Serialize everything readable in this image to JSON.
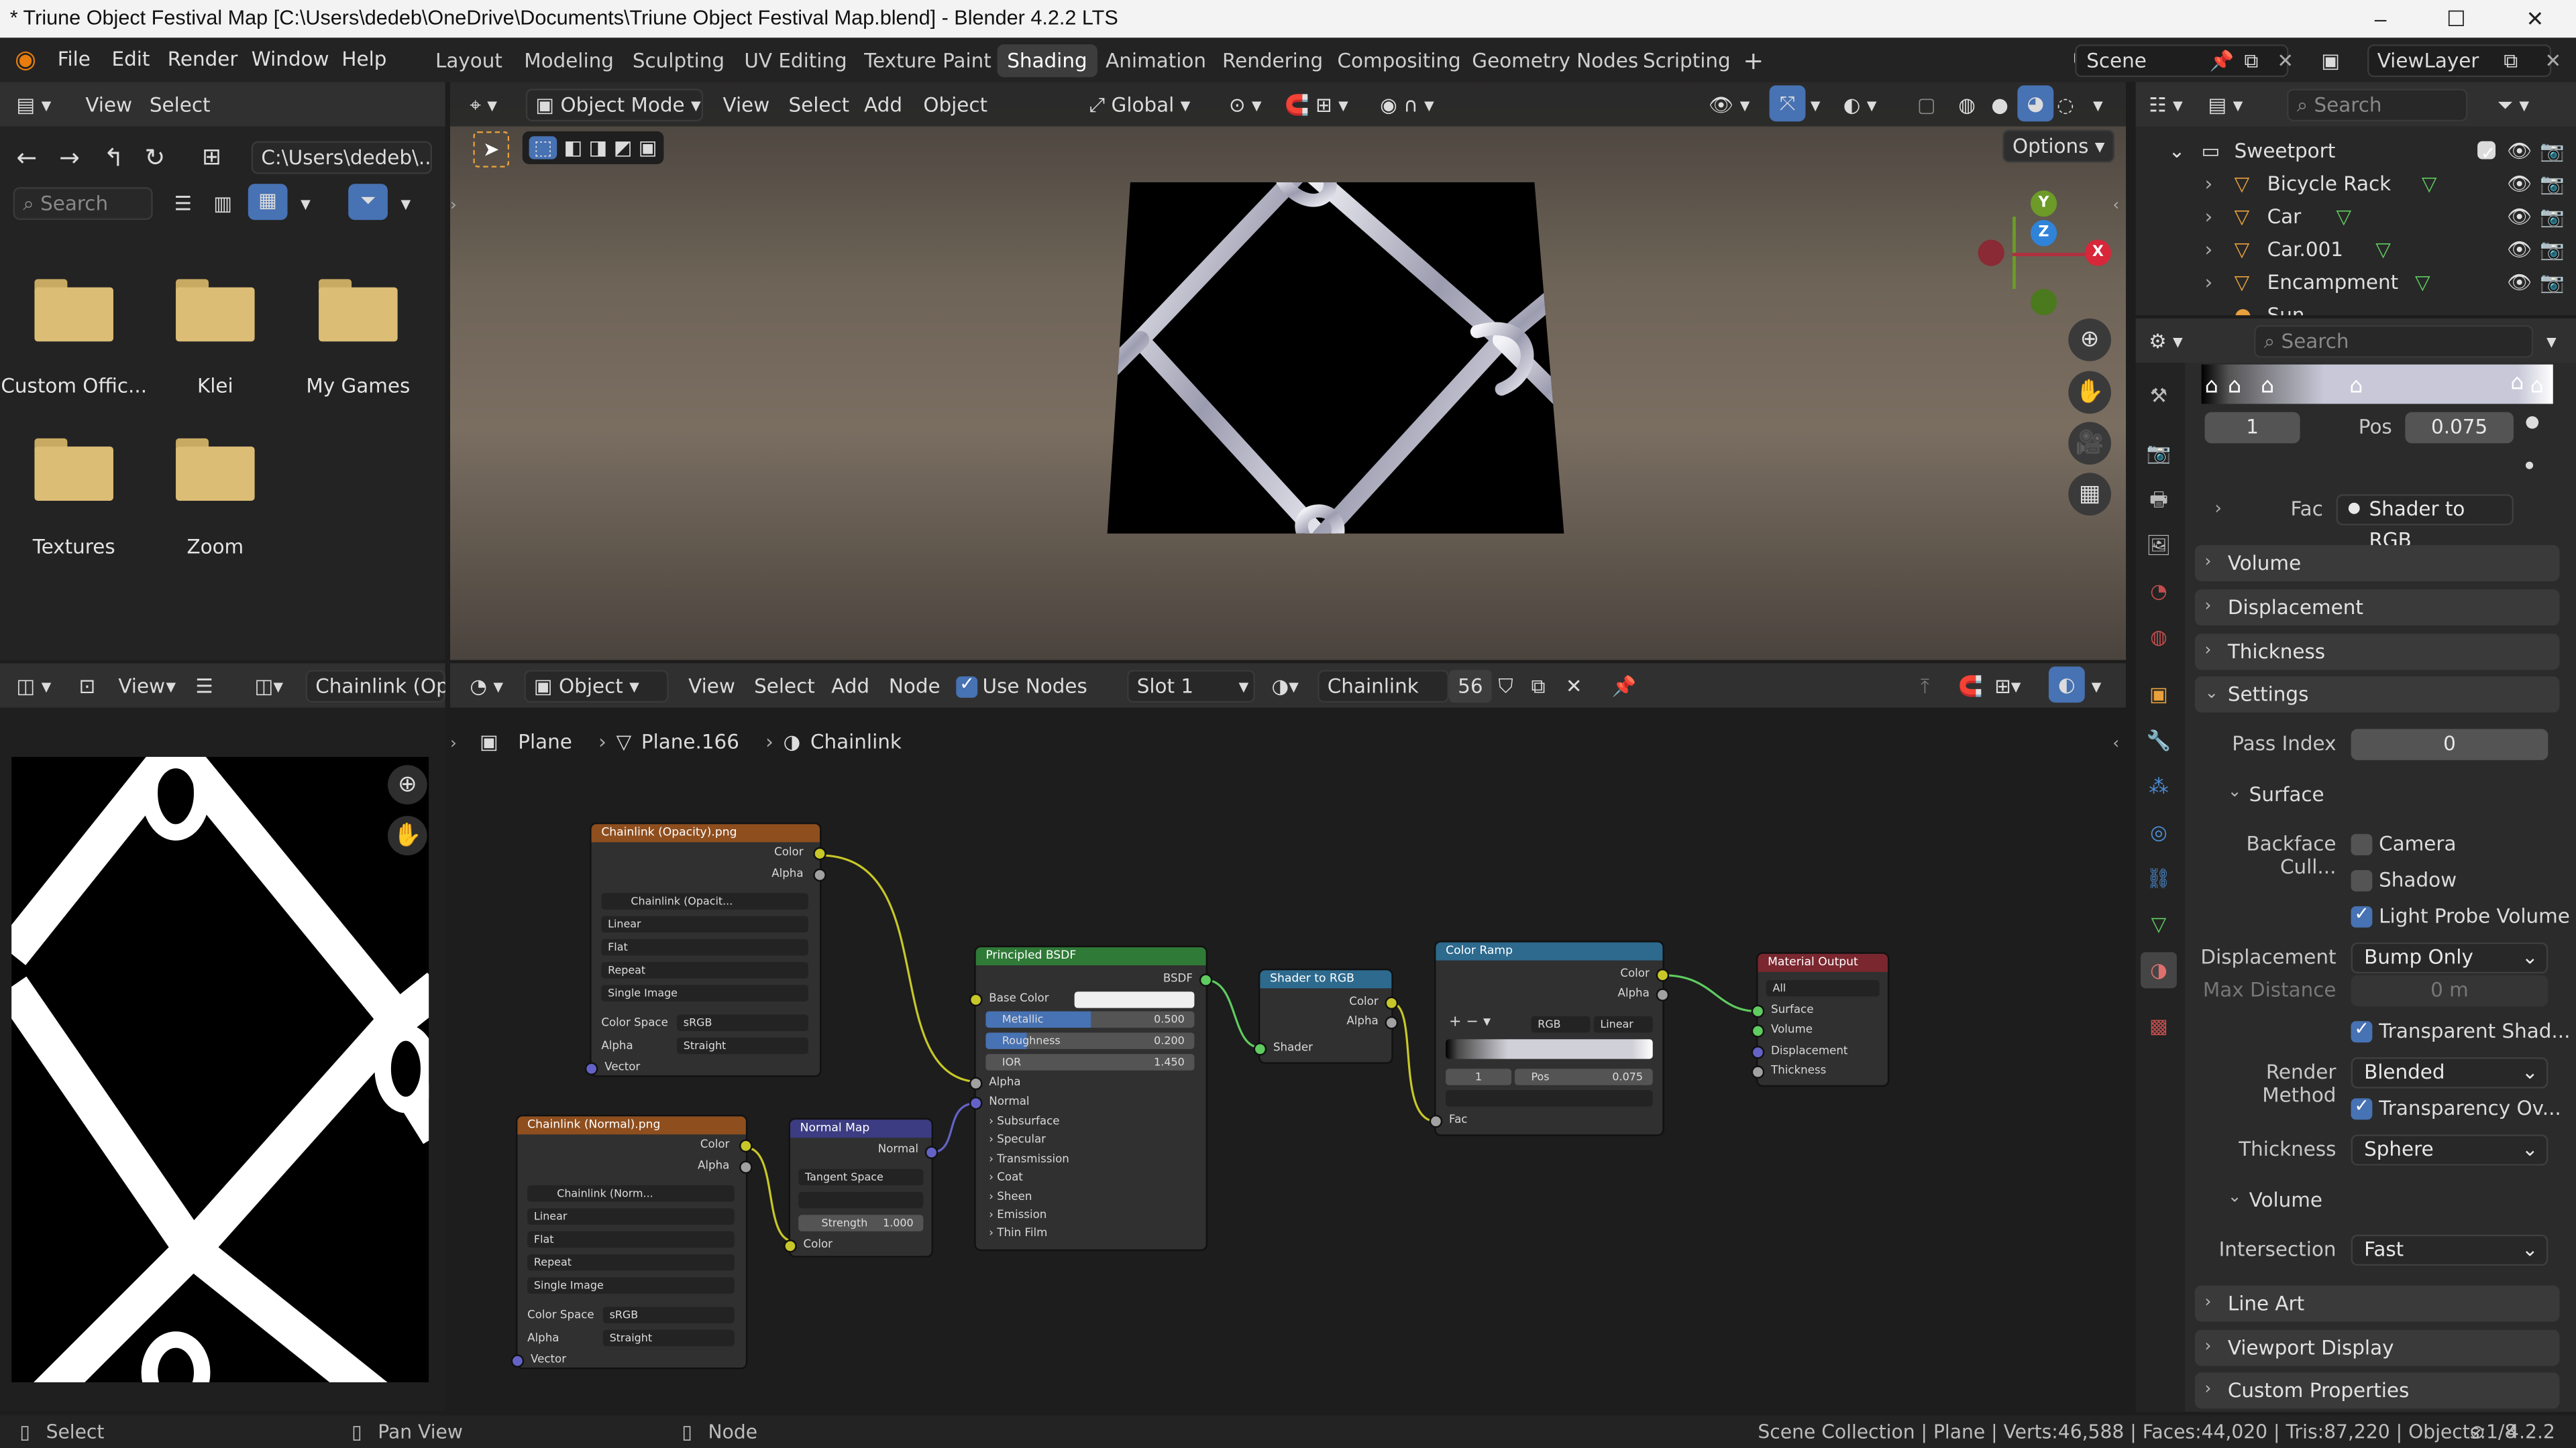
{
  "window": {
    "title": "* Triune Object Festival Map [C:\\Users\\dedeb\\OneDrive\\Documents\\Triune Object Festival Map.blend] - Blender 4.2.2 LTS",
    "minimize": "–",
    "maximize": "☐",
    "close": "✕"
  },
  "menu": [
    "File",
    "Edit",
    "Render",
    "Window",
    "Help"
  ],
  "workspaces": [
    "Layout",
    "Modeling",
    "Sculpting",
    "UV Editing",
    "Texture Paint",
    "Shading",
    "Animation",
    "Rendering",
    "Compositing",
    "Geometry Nodes",
    "Scripting",
    "+"
  ],
  "active_workspace": "Shading",
  "scene": {
    "name": "Scene",
    "view_layer": "ViewLayer"
  },
  "file_browser": {
    "menus": [
      "View",
      "Select"
    ],
    "path": "C:\\Users\\dedeb\\...",
    "search_placeholder": "Search",
    "folders": [
      "Custom Offic...",
      "Klei",
      "My Games",
      "Textures",
      "Zoom"
    ]
  },
  "viewport": {
    "mode": "Object Mode",
    "menus": [
      "View",
      "Select",
      "Add",
      "Object"
    ],
    "orientation": "Global",
    "options": "Options",
    "gizmo": {
      "x": "X",
      "y": "Y",
      "z": "Z"
    }
  },
  "image_editor": {
    "menus": [
      "View"
    ],
    "image_name": "Chainlink (Opac"
  },
  "node_editor": {
    "type": "Object",
    "menus": [
      "View",
      "Select",
      "Add",
      "Node"
    ],
    "use_nodes": "Use Nodes",
    "slot": "Slot 1",
    "material": "Chainlink",
    "users": "56",
    "breadcrumb": [
      "Plane",
      "Plane.166",
      "Chainlink"
    ],
    "nodes": {
      "opacity_tex": {
        "title": "Chainlink (Opacity).png",
        "out1": "Color",
        "out2": "Alpha",
        "img": "Chainlink (Opacit...",
        "interp": "Linear",
        "proj": "Flat",
        "ext": "Repeat",
        "src": "Single Image",
        "cs_label": "Color Space",
        "cs": "sRGB",
        "alpha_label": "Alpha",
        "alpha": "Straight",
        "in1": "Vector"
      },
      "normal_tex": {
        "title": "Chainlink (Normal).png",
        "out1": "Color",
        "out2": "Alpha",
        "img": "Chainlink (Norm...",
        "interp": "Linear",
        "proj": "Flat",
        "ext": "Repeat",
        "src": "Single Image",
        "cs_label": "Color Space",
        "cs": "sRGB",
        "alpha_label": "Alpha",
        "alpha": "Straight",
        "in1": "Vector"
      },
      "normal_map": {
        "title": "Normal Map",
        "out1": "Normal",
        "space": "Tangent Space",
        "strength_label": "Strength",
        "strength": "1.000",
        "in1": "Color"
      },
      "bsdf": {
        "title": "Principled BSDF",
        "out1": "BSDF",
        "base_color": "Base Color",
        "metallic_label": "Metallic",
        "metallic": "0.500",
        "metallic_fill": 0.5,
        "roughness_label": "Roughness",
        "roughness": "0.200",
        "roughness_fill": 0.2,
        "ior_label": "IOR",
        "ior": "1.450",
        "alpha": "Alpha",
        "normal": "Normal",
        "panels": [
          "Subsurface",
          "Specular",
          "Transmission",
          "Coat",
          "Sheen",
          "Emission",
          "Thin Film"
        ]
      },
      "shader_rgb": {
        "title": "Shader to RGB",
        "out1": "Color",
        "out2": "Alpha",
        "in1": "Shader"
      },
      "color_ramp": {
        "title": "Color Ramp",
        "out1": "Color",
        "out2": "Alpha",
        "mode": "RGB",
        "interp": "Linear",
        "idx": "1",
        "pos_label": "Pos",
        "pos": "0.075",
        "in1": "Fac"
      },
      "mat_out": {
        "title": "Material Output",
        "target": "All",
        "in1": "Surface",
        "in2": "Volume",
        "in3": "Displacement",
        "in4": "Thickness"
      }
    }
  },
  "outliner": {
    "search_placeholder": "Search",
    "collection": "Sweetport",
    "items": [
      "Bicycle Rack",
      "Car",
      "Car.001",
      "Encampment",
      "Sun"
    ]
  },
  "properties": {
    "search_placeholder": "Search",
    "ramp_index": "1",
    "pos_label": "Pos",
    "pos_value": "0.075",
    "fac_label": "Fac",
    "fac_value": "Shader to RGB",
    "sections_top": [
      "Volume",
      "Displacement",
      "Thickness",
      "Settings"
    ],
    "pass_index_label": "Pass Index",
    "pass_index": "0",
    "surface": "Surface",
    "backface_label": "Backface Cull...",
    "camera": "Camera",
    "shadow": "Shadow",
    "light_probe": "Light Probe Volume",
    "displacement_label": "Displacement",
    "displacement": "Bump Only",
    "max_distance_label": "Max Distance",
    "max_distance": "0 m",
    "transparent_shadows": "Transparent Shad...",
    "render_method_label": "Render Method",
    "render_method": "Blended",
    "transparency_overlap": "Transparency Ov...",
    "thickness_label": "Thickness",
    "thickness": "Sphere",
    "volume": "Volume",
    "intersection_label": "Intersection",
    "intersection": "Fast",
    "sections_bottom": [
      "Line Art",
      "Viewport Display",
      "Custom Properties"
    ]
  },
  "status": {
    "select": "Select",
    "pan": "Pan View",
    "node": "Node",
    "info": "Scene Collection | Plane | Verts:46,588 | Faces:44,020 | Tris:87,220 | Objects:1/8",
    "version": "4.2.2"
  },
  "colors": {
    "accent": "#4772b3",
    "header_tex": "#8e4e1e",
    "header_shader": "#2f7a37",
    "header_vector": "#3c3c83",
    "header_converter": "#2d6a8e",
    "header_output": "#7a2730",
    "socket_color": "#c7c729",
    "socket_shader": "#5fcc5f",
    "socket_vector": "#6363c7",
    "socket_gray": "#a1a1a1"
  }
}
